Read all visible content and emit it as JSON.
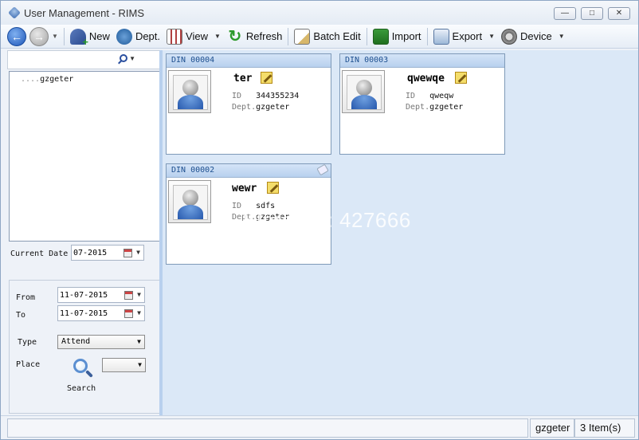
{
  "window": {
    "title": "User Management - RIMS",
    "controls": [
      "minimize",
      "maximize",
      "close"
    ]
  },
  "toolbar": {
    "new_label": "New",
    "dept_label": "Dept.",
    "view_label": "View",
    "refresh_label": "Refresh",
    "batch_edit_label": "Batch Edit",
    "import_label": "Import",
    "export_label": "Export",
    "device_label": "Device"
  },
  "tree": {
    "nodes": [
      {
        "label": "gzgeter"
      }
    ]
  },
  "filters": {
    "current_date_label": "Current Date",
    "current_date_value": "07-2015",
    "from_label": "From",
    "from_value": "11-07-2015",
    "to_label": "To",
    "to_value": "11-07-2015",
    "type_label": "Type",
    "type_value": "Attend",
    "place_label": "Place",
    "place_value": "",
    "search_label": "Search"
  },
  "cards": [
    {
      "din": "DIN 00004",
      "name": "ter",
      "id_label": "ID",
      "id_value": "344355234",
      "dept_label": "Dept.",
      "dept_value": "gzgeter"
    },
    {
      "din": "DIN 00003",
      "name": "qwewqe",
      "id_label": "ID",
      "id_value": "qweqw",
      "dept_label": "Dept.",
      "dept_value": "gzgeter"
    },
    {
      "din": "DIN 00002",
      "name": "wewr",
      "id_label": "ID",
      "id_value": "sdfs",
      "dept_label": "Dept.",
      "dept_value": "gzgeter"
    }
  ],
  "watermark": "Store No: 427666",
  "status": {
    "user": "gzgeter",
    "count": "3 Item(s)"
  },
  "colors": {
    "content_bg": "#dbe8f7",
    "card_header": "#b8d0ee",
    "accent": "#1e56b8"
  }
}
